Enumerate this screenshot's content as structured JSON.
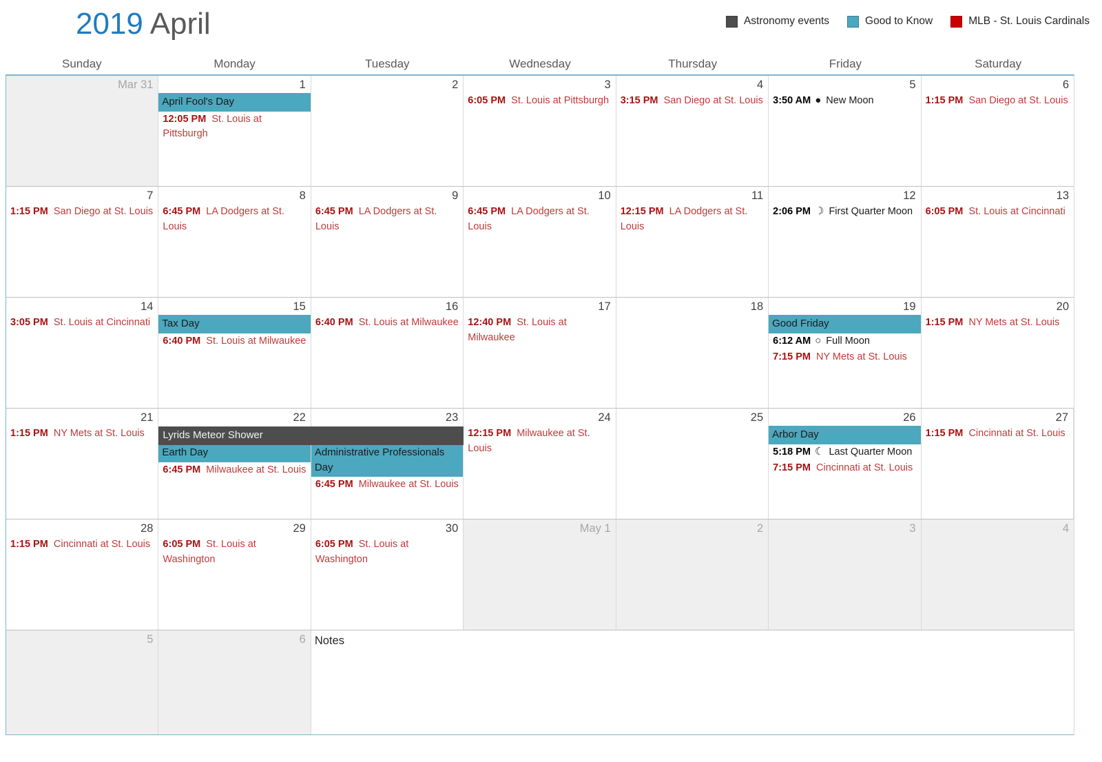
{
  "header": {
    "year": "2019",
    "month": "April",
    "legend": [
      {
        "label": "Astronomy events",
        "color": "#4D4D4D"
      },
      {
        "label": "Good to Know",
        "color": "#4BA8BE"
      },
      {
        "label": "MLB - St. Louis Cardinals",
        "color": "#CC0000"
      }
    ]
  },
  "weekdays": [
    "Sunday",
    "Monday",
    "Tuesday",
    "Wednesday",
    "Thursday",
    "Friday",
    "Saturday"
  ],
  "weeks": [
    {
      "band": {
        "label": "",
        "start": -1,
        "span": 0
      },
      "days": [
        {
          "num": "Mar 31",
          "other": true,
          "events": []
        },
        {
          "num": "1",
          "other": false,
          "events": [
            {
              "kind": "holiday",
              "text": "April Fool's Day"
            },
            {
              "kind": "mlb",
              "time": "12:05 PM",
              "desc": "St. Louis at Pittsburgh"
            }
          ]
        },
        {
          "num": "2",
          "other": false,
          "events": []
        },
        {
          "num": "3",
          "other": false,
          "events": [
            {
              "kind": "mlb",
              "time": "6:05 PM",
              "desc": "St. Louis at Pittsburgh"
            }
          ]
        },
        {
          "num": "4",
          "other": false,
          "events": [
            {
              "kind": "mlb",
              "time": "3:15 PM",
              "desc": "San Diego at St. Louis"
            }
          ]
        },
        {
          "num": "5",
          "other": false,
          "events": [
            {
              "kind": "astro",
              "time": "3:50 AM",
              "glyph": "●",
              "desc": "New Moon"
            }
          ]
        },
        {
          "num": "6",
          "other": false,
          "events": [
            {
              "kind": "mlb",
              "time": "1:15 PM",
              "desc": "San Diego at St. Louis"
            }
          ]
        }
      ]
    },
    {
      "band": {
        "label": "",
        "start": -1,
        "span": 0
      },
      "days": [
        {
          "num": "7",
          "other": false,
          "events": [
            {
              "kind": "mlb",
              "time": "1:15 PM",
              "desc": "San Diego at St. Louis"
            }
          ]
        },
        {
          "num": "8",
          "other": false,
          "events": [
            {
              "kind": "mlb",
              "time": "6:45 PM",
              "desc": "LA Dodgers at St. Louis"
            }
          ]
        },
        {
          "num": "9",
          "other": false,
          "events": [
            {
              "kind": "mlb",
              "time": "6:45 PM",
              "desc": "LA Dodgers at St. Louis"
            }
          ]
        },
        {
          "num": "10",
          "other": false,
          "events": [
            {
              "kind": "mlb",
              "time": "6:45 PM",
              "desc": "LA Dodgers at St. Louis"
            }
          ]
        },
        {
          "num": "11",
          "other": false,
          "events": [
            {
              "kind": "mlb",
              "time": "12:15 PM",
              "desc": "LA Dodgers at St. Louis"
            }
          ]
        },
        {
          "num": "12",
          "other": false,
          "events": [
            {
              "kind": "astro",
              "time": "2:06 PM",
              "glyph": "☽",
              "desc": "First Quarter Moon"
            }
          ]
        },
        {
          "num": "13",
          "other": false,
          "events": [
            {
              "kind": "mlb",
              "time": "6:05 PM",
              "desc": "St. Louis at Cincinnati"
            }
          ]
        }
      ]
    },
    {
      "band": {
        "label": "",
        "start": -1,
        "span": 0
      },
      "days": [
        {
          "num": "14",
          "other": false,
          "events": [
            {
              "kind": "mlb",
              "time": "3:05 PM",
              "desc": "St. Louis at Cincinnati"
            }
          ]
        },
        {
          "num": "15",
          "other": false,
          "events": [
            {
              "kind": "holiday",
              "text": "Tax Day"
            },
            {
              "kind": "mlb",
              "time": "6:40 PM",
              "desc": "St. Louis at Milwaukee"
            }
          ]
        },
        {
          "num": "16",
          "other": false,
          "events": [
            {
              "kind": "mlb",
              "time": "6:40 PM",
              "desc": "St. Louis at Milwaukee"
            }
          ]
        },
        {
          "num": "17",
          "other": false,
          "events": [
            {
              "kind": "mlb",
              "time": "12:40 PM",
              "desc": "St. Louis at Milwaukee"
            }
          ]
        },
        {
          "num": "18",
          "other": false,
          "events": []
        },
        {
          "num": "19",
          "other": false,
          "events": [
            {
              "kind": "holiday",
              "text": "Good Friday"
            },
            {
              "kind": "astro",
              "time": "6:12 AM",
              "glyph": "○",
              "desc": "Full Moon"
            },
            {
              "kind": "mlb",
              "time": "7:15 PM",
              "desc": "NY Mets at St. Louis"
            }
          ]
        },
        {
          "num": "20",
          "other": false,
          "events": [
            {
              "kind": "mlb",
              "time": "1:15 PM",
              "desc": "NY Mets at St. Louis"
            }
          ]
        }
      ]
    },
    {
      "band": {
        "label": "Lyrids Meteor Shower",
        "start": 1,
        "span": 2
      },
      "days": [
        {
          "num": "21",
          "other": false,
          "events": [
            {
              "kind": "mlb",
              "time": "1:15 PM",
              "desc": "NY Mets at St. Louis"
            }
          ]
        },
        {
          "num": "22",
          "other": false,
          "events": [
            {
              "kind": "spacer"
            },
            {
              "kind": "holiday",
              "text": "Earth Day"
            },
            {
              "kind": "mlb",
              "time": "6:45 PM",
              "desc": "Milwaukee at St. Louis"
            }
          ]
        },
        {
          "num": "23",
          "other": false,
          "events": [
            {
              "kind": "spacer"
            },
            {
              "kind": "holiday",
              "text": "Administrative Professionals Day"
            },
            {
              "kind": "mlb",
              "time": "6:45 PM",
              "desc": "Milwaukee at St. Louis"
            }
          ]
        },
        {
          "num": "24",
          "other": false,
          "events": [
            {
              "kind": "mlb",
              "time": "12:15 PM",
              "desc": "Milwaukee at St. Louis"
            }
          ]
        },
        {
          "num": "25",
          "other": false,
          "events": []
        },
        {
          "num": "26",
          "other": false,
          "events": [
            {
              "kind": "holiday",
              "text": "Arbor Day"
            },
            {
              "kind": "astro",
              "time": "5:18 PM",
              "glyph": "☾",
              "desc": "Last Quarter Moon"
            },
            {
              "kind": "mlb",
              "time": "7:15 PM",
              "desc": "Cincinnati at St. Louis"
            }
          ]
        },
        {
          "num": "27",
          "other": false,
          "events": [
            {
              "kind": "mlb",
              "time": "1:15 PM",
              "desc": "Cincinnati at St. Louis"
            }
          ]
        }
      ]
    },
    {
      "band": {
        "label": "",
        "start": -1,
        "span": 0
      },
      "days": [
        {
          "num": "28",
          "other": false,
          "events": [
            {
              "kind": "mlb",
              "time": "1:15 PM",
              "desc": "Cincinnati at St. Louis"
            }
          ]
        },
        {
          "num": "29",
          "other": false,
          "events": [
            {
              "kind": "mlb",
              "time": "6:05 PM",
              "desc": "St. Louis at Washington"
            }
          ]
        },
        {
          "num": "30",
          "other": false,
          "events": [
            {
              "kind": "mlb",
              "time": "6:05 PM",
              "desc": "St. Louis at Washington"
            }
          ]
        },
        {
          "num": "May 1",
          "other": true,
          "events": []
        },
        {
          "num": "2",
          "other": true,
          "events": []
        },
        {
          "num": "3",
          "other": true,
          "events": []
        },
        {
          "num": "4",
          "other": true,
          "events": []
        }
      ]
    },
    {
      "band": {
        "label": "",
        "start": -1,
        "span": 0
      },
      "notes_row": true,
      "notes_label": "Notes",
      "days": [
        {
          "num": "5",
          "other": true,
          "events": []
        },
        {
          "num": "6",
          "other": true,
          "events": []
        }
      ]
    }
  ]
}
